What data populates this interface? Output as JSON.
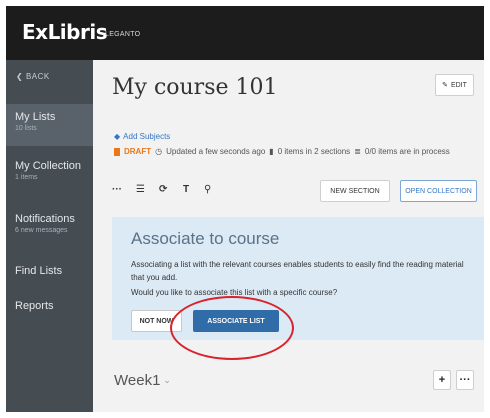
{
  "brand": {
    "logo": "ExLibris",
    "product": "LEGANTO"
  },
  "sidebar": {
    "back_label": "BACK",
    "items": [
      {
        "label": "My Lists",
        "sub": "10 lists",
        "active": true
      },
      {
        "label": "My Collection",
        "sub": "1 items"
      },
      {
        "label": "Notifications",
        "sub": "6 new messages"
      },
      {
        "label": "Find Lists",
        "sub": ""
      },
      {
        "label": "Reports",
        "sub": ""
      }
    ]
  },
  "main": {
    "title": "My course 101",
    "edit_label": "EDIT",
    "add_subjects": "Add Subjects",
    "status": {
      "draft": "DRAFT",
      "updated": "Updated a few seconds ago",
      "items_sections": "0 items in 2 sections",
      "process": "0/0 items are in process"
    },
    "toolbar": {
      "new_section": "NEW SECTION",
      "open_collection": "OPEN COLLECTION"
    },
    "associate": {
      "title": "Associate to course",
      "description": "Associating a list with the relevant courses enables students to easily find the reading material that you add.",
      "question": "Would you like to associate this list with a specific course?",
      "not_now": "NOT NOW",
      "associate_list": "ASSOCIATE LIST"
    },
    "section": {
      "title": "Week1"
    }
  },
  "colors": {
    "topbar": "#1c1c1c",
    "sidebar": "#454c52",
    "accent": "#2f6ca8",
    "draft": "#e8781a",
    "highlight_circle": "#d9232d"
  }
}
